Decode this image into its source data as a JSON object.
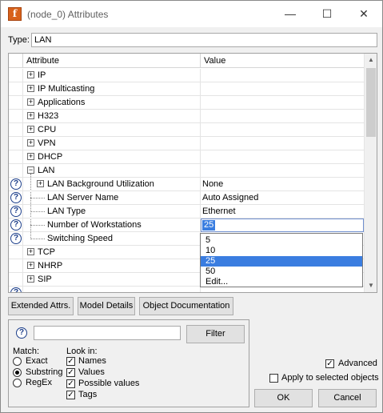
{
  "window": {
    "title": "(node_0) Attributes",
    "icon_letter": "f"
  },
  "titlebar": {
    "minimize": "—",
    "maximize": "☐",
    "close": "✕"
  },
  "type": {
    "label": "Type:",
    "value": "LAN"
  },
  "grid": {
    "headers": {
      "attribute": "Attribute",
      "value": "Value"
    },
    "groups": [
      {
        "label": "IP",
        "expander": "+"
      },
      {
        "label": "IP Multicasting",
        "expander": "+"
      },
      {
        "label": "Applications",
        "expander": "+"
      },
      {
        "label": "H323",
        "expander": "+"
      },
      {
        "label": "CPU",
        "expander": "+"
      },
      {
        "label": "VPN",
        "expander": "+"
      },
      {
        "label": "DHCP",
        "expander": "+"
      },
      {
        "label": "LAN",
        "expander": "−"
      }
    ],
    "lan_rows": [
      {
        "label": "LAN Background Utilization",
        "value": "None",
        "expander": "+"
      },
      {
        "label": "LAN Server Name",
        "value": "Auto Assigned"
      },
      {
        "label": "LAN Type",
        "value": "Ethernet"
      },
      {
        "label": "Number of Workstations",
        "value": "25"
      },
      {
        "label": "Switching Speed",
        "value": ""
      }
    ],
    "more_groups": [
      {
        "label": "TCP",
        "expander": "+"
      },
      {
        "label": "NHRP",
        "expander": "+"
      },
      {
        "label": "SIP",
        "expander": "+"
      }
    ],
    "dropdown_options": [
      "5",
      "10",
      "25",
      "50",
      "Edit..."
    ],
    "dropdown_selected": "25"
  },
  "buttons": {
    "extended": "Extended Attrs.",
    "model_details": "Model Details",
    "object_doc": "Object Documentation",
    "filter": "Filter",
    "ok": "OK",
    "cancel": "Cancel"
  },
  "search": {
    "value": "",
    "match_label": "Match:",
    "match_options": [
      {
        "label": "Exact",
        "selected": false
      },
      {
        "label": "Substring",
        "selected": true
      },
      {
        "label": "RegEx",
        "selected": false
      }
    ],
    "lookin_label": "Look in:",
    "lookin_options": [
      {
        "label": "Names",
        "checked": true
      },
      {
        "label": "Values",
        "checked": true
      },
      {
        "label": "Possible values",
        "checked": true
      },
      {
        "label": "Tags",
        "checked": true
      }
    ]
  },
  "advanced": {
    "label": "Advanced",
    "checked": true
  },
  "apply_selected": {
    "label": "Apply to selected objects",
    "checked": false
  },
  "icons": {
    "help": "?",
    "check": "✓"
  },
  "colors": {
    "accent": "#3a7de0",
    "app_icon": "#d8621b",
    "help_icon": "#1c3e8a"
  }
}
